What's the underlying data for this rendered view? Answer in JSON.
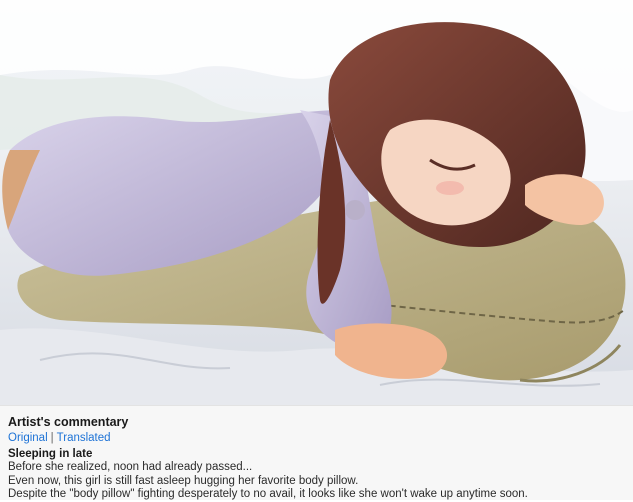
{
  "artwork": {
    "description_icon": "illustration-image"
  },
  "commentary": {
    "title": "Artist's commentary",
    "tabs": [
      "Original",
      "Translated"
    ],
    "separator": "|",
    "subtitle": "Sleeping in late",
    "lines": [
      "Before she realized, noon had already passed...",
      "Even now, this girl is still fast asleep hugging her favorite body pillow.",
      "Despite the \"body pillow\" fighting desperately to no avail, it looks like she won't wake up anytime soon."
    ]
  },
  "colors": {
    "link": "#1e73d6",
    "panel_bg": "#f7f7f7"
  }
}
